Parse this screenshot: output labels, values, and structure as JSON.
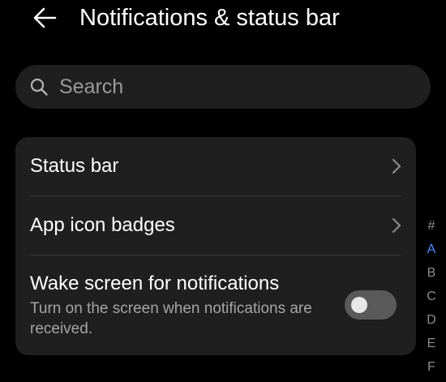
{
  "header": {
    "back_icon": "arrow-left-icon",
    "title": "Notifications & status bar"
  },
  "search": {
    "icon": "search-icon",
    "placeholder": "Search",
    "value": ""
  },
  "settings": {
    "items": [
      {
        "label": "Status bar",
        "icon": "chevron-right-icon"
      },
      {
        "label": "App icon badges",
        "icon": "chevron-right-icon"
      },
      {
        "label": "Wake screen for notifications",
        "description": "Turn on the screen when notifications are received.",
        "toggle_on": false
      }
    ]
  },
  "index_bar": {
    "letters": [
      "#",
      "A",
      "B",
      "C",
      "D",
      "E",
      "F"
    ],
    "active": "A"
  },
  "colors": {
    "background": "#000000",
    "card": "#1f1f1f",
    "accent": "#4a8cff",
    "toggle_off": "#5a5a5a"
  }
}
